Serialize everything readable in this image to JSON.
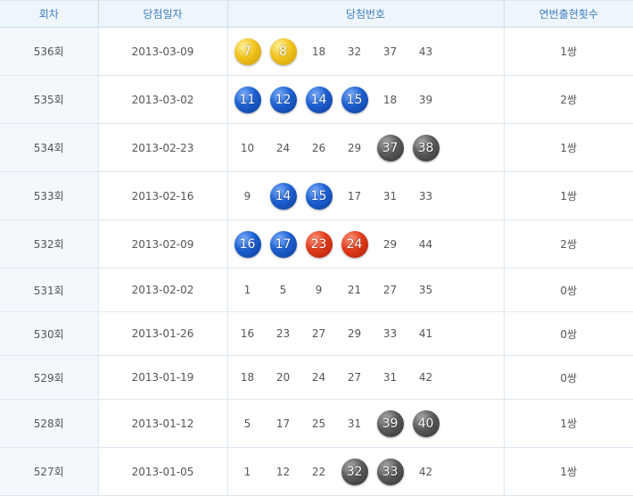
{
  "headers": [
    "회차",
    "당첨일자",
    "당첨번호",
    "연번출현횟수"
  ],
  "ball_colors": {
    "yellow": "#f2c21c",
    "blue": "#1d5fd0",
    "red": "#e03a1a",
    "gray": "#5a5a5a"
  },
  "rows": [
    {
      "round": "536회",
      "date": "2013-03-09",
      "count": "1쌍",
      "numbers": [
        {
          "v": "7",
          "c": "yellow"
        },
        {
          "v": "8",
          "c": "yellow"
        },
        {
          "v": "18"
        },
        {
          "v": "32"
        },
        {
          "v": "37"
        },
        {
          "v": "43"
        }
      ]
    },
    {
      "round": "535회",
      "date": "2013-03-02",
      "count": "2쌍",
      "numbers": [
        {
          "v": "11",
          "c": "blue"
        },
        {
          "v": "12",
          "c": "blue"
        },
        {
          "v": "14",
          "c": "blue"
        },
        {
          "v": "15",
          "c": "blue"
        },
        {
          "v": "18"
        },
        {
          "v": "39"
        }
      ]
    },
    {
      "round": "534회",
      "date": "2013-02-23",
      "count": "1쌍",
      "numbers": [
        {
          "v": "10"
        },
        {
          "v": "24"
        },
        {
          "v": "26"
        },
        {
          "v": "29"
        },
        {
          "v": "37",
          "c": "gray"
        },
        {
          "v": "38",
          "c": "gray"
        }
      ]
    },
    {
      "round": "533회",
      "date": "2013-02-16",
      "count": "1쌍",
      "numbers": [
        {
          "v": "9"
        },
        {
          "v": "14",
          "c": "blue"
        },
        {
          "v": "15",
          "c": "blue"
        },
        {
          "v": "17"
        },
        {
          "v": "31"
        },
        {
          "v": "33"
        }
      ]
    },
    {
      "round": "532회",
      "date": "2013-02-09",
      "count": "2쌍",
      "numbers": [
        {
          "v": "16",
          "c": "blue"
        },
        {
          "v": "17",
          "c": "blue"
        },
        {
          "v": "23",
          "c": "red"
        },
        {
          "v": "24",
          "c": "red"
        },
        {
          "v": "29"
        },
        {
          "v": "44"
        }
      ]
    },
    {
      "round": "531회",
      "date": "2013-02-02",
      "count": "0쌍",
      "numbers": [
        {
          "v": "1"
        },
        {
          "v": "5"
        },
        {
          "v": "9"
        },
        {
          "v": "21"
        },
        {
          "v": "27"
        },
        {
          "v": "35"
        }
      ]
    },
    {
      "round": "530회",
      "date": "2013-01-26",
      "count": "0쌍",
      "numbers": [
        {
          "v": "16"
        },
        {
          "v": "23"
        },
        {
          "v": "27"
        },
        {
          "v": "29"
        },
        {
          "v": "33"
        },
        {
          "v": "41"
        }
      ]
    },
    {
      "round": "529회",
      "date": "2013-01-19",
      "count": "0쌍",
      "numbers": [
        {
          "v": "18"
        },
        {
          "v": "20"
        },
        {
          "v": "24"
        },
        {
          "v": "27"
        },
        {
          "v": "31"
        },
        {
          "v": "42"
        }
      ]
    },
    {
      "round": "528회",
      "date": "2013-01-12",
      "count": "1쌍",
      "numbers": [
        {
          "v": "5"
        },
        {
          "v": "17"
        },
        {
          "v": "25"
        },
        {
          "v": "31"
        },
        {
          "v": "39",
          "c": "gray"
        },
        {
          "v": "40",
          "c": "gray"
        }
      ]
    },
    {
      "round": "527회",
      "date": "2013-01-05",
      "count": "1쌍",
      "numbers": [
        {
          "v": "1"
        },
        {
          "v": "12"
        },
        {
          "v": "22"
        },
        {
          "v": "32",
          "c": "gray"
        },
        {
          "v": "33",
          "c": "gray"
        },
        {
          "v": "42"
        }
      ]
    }
  ]
}
